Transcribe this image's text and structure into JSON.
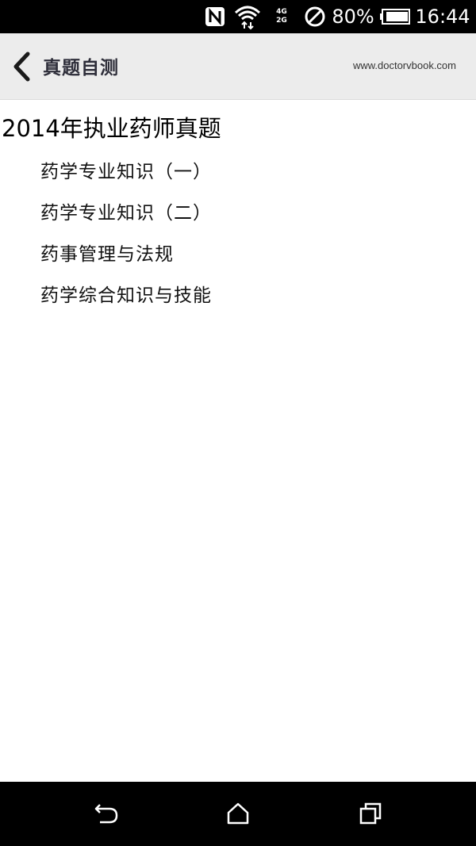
{
  "status_bar": {
    "nfc_icon": "nfc-icon",
    "wifi_icon": "wifi-icon",
    "signal_top": "4G",
    "signal_bottom": "2G",
    "dnd_icon": "do-not-disturb-icon",
    "battery_percent": "80%",
    "battery_icon": "battery-icon",
    "time": "16:44"
  },
  "header": {
    "back_icon": "chevron-left-icon",
    "title": "真题自测",
    "url": "www.doctorvbook.com"
  },
  "section": {
    "title": "2014年执业药师真题",
    "items": [
      {
        "label": "药学专业知识（一）"
      },
      {
        "label": "药学专业知识（二）"
      },
      {
        "label": "药事管理与法规"
      },
      {
        "label": "药学综合知识与技能"
      }
    ]
  },
  "nav_bar": {
    "back_icon": "nav-back-icon",
    "home_icon": "home-icon",
    "recent_icon": "recent-apps-icon"
  },
  "colors": {
    "header_bg": "#ececec",
    "status_bg": "#000000",
    "nav_bg": "#000000",
    "text": "#111111"
  }
}
